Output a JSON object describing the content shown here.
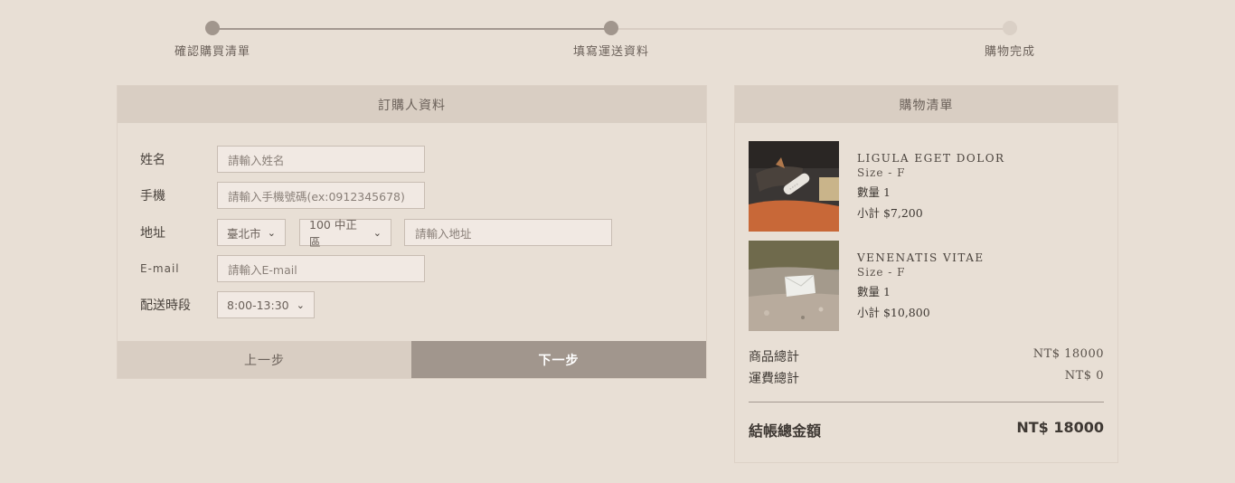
{
  "stepper": {
    "steps": [
      {
        "label": "確認購買清單",
        "state": "done"
      },
      {
        "label": "填寫運送資料",
        "state": "current"
      },
      {
        "label": "購物完成",
        "state": "todo"
      }
    ]
  },
  "order_form": {
    "title": "訂購人資料",
    "name": {
      "label": "姓名",
      "placeholder": "請輸入姓名"
    },
    "phone": {
      "label": "手機",
      "placeholder": "請輸入手機號碼(ex:0912345678)"
    },
    "address": {
      "label": "地址",
      "city": "臺北市",
      "district": "100 中正區",
      "placeholder": "請輸入地址"
    },
    "email": {
      "label": "E-mail",
      "placeholder": "請輸入E-mail"
    },
    "delivery": {
      "label": "配送時段",
      "value": "8:00-13:30"
    },
    "prev_label": "上一步",
    "next_label": "下一步"
  },
  "cart": {
    "title": "購物清單",
    "items": [
      {
        "name": "LIGULA EGET DOLOR",
        "size": "Size - F",
        "qty": "數量 1",
        "subtotal": "小計 $7,200",
        "image": "leather-tag-photo"
      },
      {
        "name": "VENENATIS VITAE",
        "size": "Size - F",
        "qty": "數量 1",
        "subtotal": "小計 $10,800",
        "image": "white-pouch-on-rock-photo"
      }
    ],
    "goods_total_label": "商品總計",
    "goods_total_value": "NT$ 18000",
    "shipping_label": "運費總計",
    "shipping_value": "NT$ 0",
    "checkout_label": "結帳總金額",
    "checkout_value": "NT$ 18000"
  },
  "colors": {
    "background": "#e8dfd5",
    "panel_header": "#d9cec3",
    "accent": "#a1968d"
  }
}
